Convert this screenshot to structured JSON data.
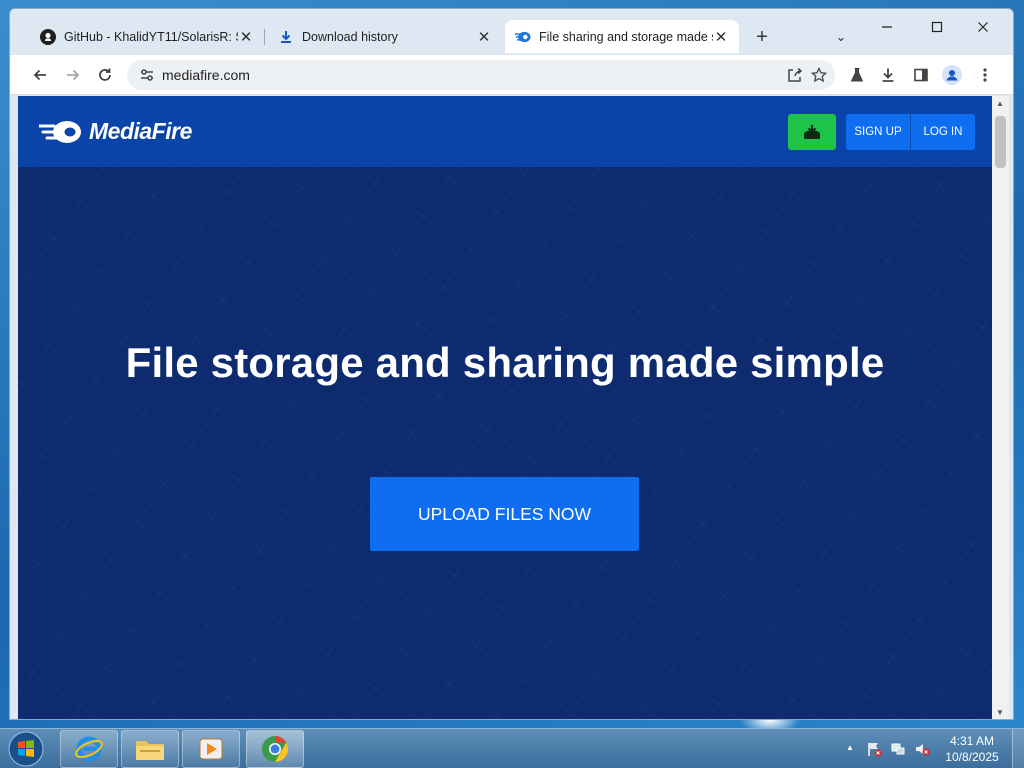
{
  "browser": {
    "tabs": [
      {
        "title": "GitHub - KhalidYT11/SolarisR: Sc",
        "icon": "github-icon",
        "active": false
      },
      {
        "title": "Download history",
        "icon": "download-icon",
        "active": false
      },
      {
        "title": "File sharing and storage made s",
        "icon": "mediafire-icon",
        "active": true
      }
    ],
    "close_glyph": "✕",
    "new_tab_glyph": "+",
    "tab_list_glyph": "⌄",
    "url": "mediafire.com"
  },
  "site": {
    "brand": "MediaFire",
    "signup_label": "SIGN UP",
    "login_label": "LOG IN",
    "headline": "File storage and sharing made simple",
    "upload_label": "UPLOAD FILES NOW",
    "colors": {
      "header_bg": "#0a44a9",
      "hero_bg": "#0d2b6e",
      "accent_blue": "#0f6df0",
      "download_green": "#1ec34a"
    }
  },
  "taskbar": {
    "time": "4:31 AM",
    "date": "10/8/2025",
    "tray_arrow": "▲"
  }
}
